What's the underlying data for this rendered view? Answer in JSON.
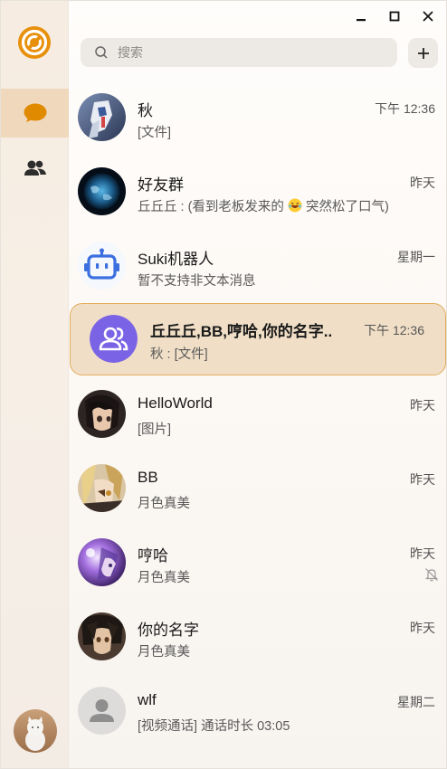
{
  "window": {
    "controls": [
      "minimize",
      "maximize",
      "close"
    ]
  },
  "sidebar": {
    "nav": [
      {
        "name": "chat",
        "icon": "chat-bubble-icon",
        "active": true
      },
      {
        "name": "contacts",
        "icon": "contacts-icon",
        "active": false
      }
    ],
    "accent": "#e08a00"
  },
  "search": {
    "placeholder": "搜索"
  },
  "chats": [
    {
      "name": "秋",
      "time": "下午 12:36",
      "preview": "[文件]",
      "avatar": "robot-anime"
    },
    {
      "name": "好友群",
      "time": "昨天",
      "preview_parts": [
        "丘丘丘 : (看到老板发来的",
        "突然松了口气)"
      ],
      "avatar": "earth"
    },
    {
      "name": "Suki机器人",
      "time": "星期一",
      "preview": "暂不支持非文本消息",
      "avatar": "bot-icon"
    },
    {
      "name": "丘丘丘,BB,哼哈,你的名字..",
      "time": "下午 12:36",
      "preview": "秋 : [文件]",
      "avatar": "group-icon",
      "selected": true
    },
    {
      "name": "HelloWorld",
      "time": "昨天",
      "preview": "[图片]",
      "avatar": "anime-dark"
    },
    {
      "name": "BB",
      "time": "昨天",
      "preview": "月色真美",
      "avatar": "anime-blonde"
    },
    {
      "name": "哼哈",
      "time": "昨天",
      "preview": "月色真美",
      "avatar": "anime-purple",
      "muted": true
    },
    {
      "name": "你的名字",
      "time": "昨天",
      "preview": "月色真美",
      "avatar": "anime-dark2"
    },
    {
      "name": "wlf",
      "time": "星期二",
      "preview": "[视频通话] 通话时长 03:05",
      "avatar": "default-user"
    }
  ]
}
